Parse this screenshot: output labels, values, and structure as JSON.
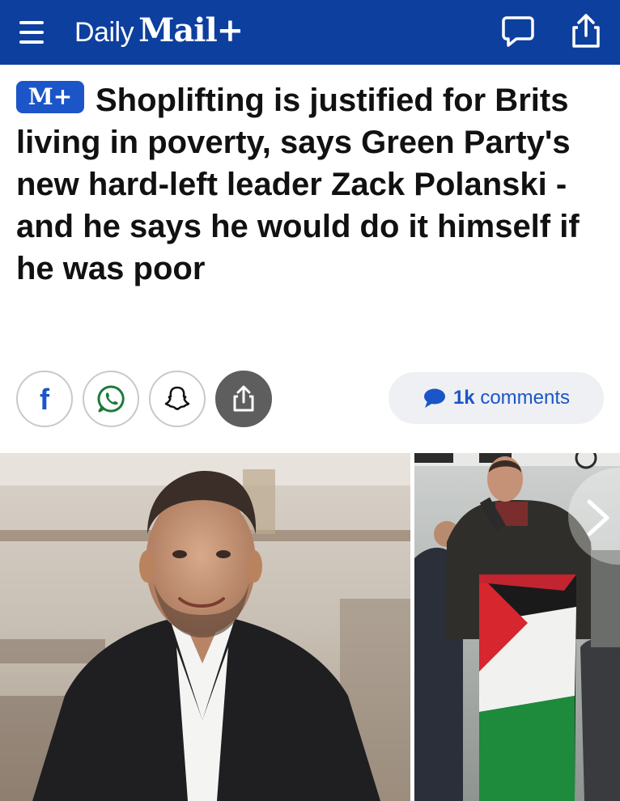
{
  "header": {
    "brand_daily": "Daily",
    "brand_mail": "Mail+",
    "background_color": "#0d3f9e",
    "icons": [
      "menu-icon",
      "comment-icon",
      "share-icon"
    ]
  },
  "article": {
    "badge": "M+",
    "headline": "Shoplifting is justified for Brits living in poverty, says Green Party's new hard-left leader Zack Polanski - and he says he would do it himself if he was poor"
  },
  "share": {
    "buttons": [
      "facebook-icon",
      "whatsapp-icon",
      "snapchat-icon",
      "share-icon"
    ],
    "facebook_glyph": "f"
  },
  "comments": {
    "count": "1k",
    "label": "comments",
    "accent_color": "#1b55c8"
  },
  "gallery": {
    "images": [
      "portrait-photo",
      "rally-photo"
    ],
    "next_icon": "chevron-right-icon"
  }
}
